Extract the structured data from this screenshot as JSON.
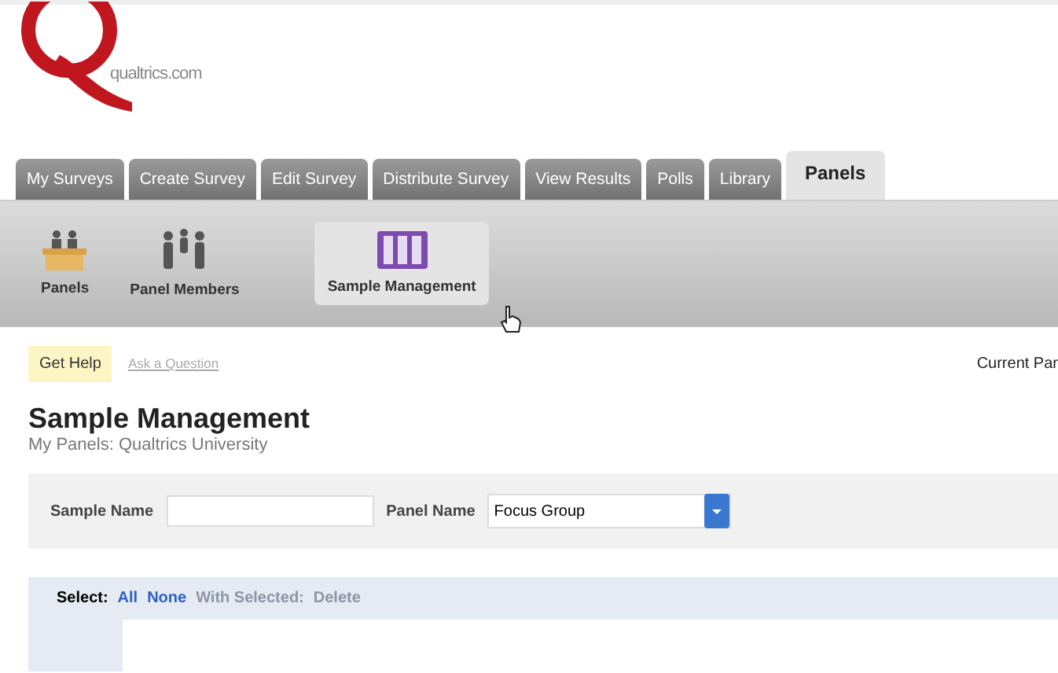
{
  "logo": {
    "text": "qualtrics.com"
  },
  "tabs": [
    {
      "label": "My Surveys",
      "selected": false
    },
    {
      "label": "Create Survey",
      "selected": false
    },
    {
      "label": "Edit Survey",
      "selected": false
    },
    {
      "label": "Distribute Survey",
      "selected": false
    },
    {
      "label": "View Results",
      "selected": false
    },
    {
      "label": "Polls",
      "selected": false
    },
    {
      "label": "Library",
      "selected": false
    },
    {
      "label": "Panels",
      "selected": true
    }
  ],
  "toolbar": [
    {
      "kind": "panels",
      "label": "Panels",
      "selected": false
    },
    {
      "kind": "members",
      "label": "Panel Members",
      "selected": false
    },
    {
      "kind": "sample",
      "label": "Sample Management",
      "selected": true
    }
  ],
  "help": {
    "button": "Get Help",
    "link": "Ask a Question",
    "current": "Current Par"
  },
  "page": {
    "title": "Sample Management",
    "subtitle": "My Panels: Qualtrics University"
  },
  "filters": {
    "sample_label": "Sample Name",
    "panel_label": "Panel Name",
    "panel_value": "Focus Group"
  },
  "select_bar": {
    "label": "Select:",
    "links": [
      {
        "label": "All",
        "disabled": false
      },
      {
        "label": "None",
        "disabled": false
      },
      {
        "label": "With Selected:",
        "disabled": true
      },
      {
        "label": "Delete",
        "disabled": true
      }
    ]
  }
}
